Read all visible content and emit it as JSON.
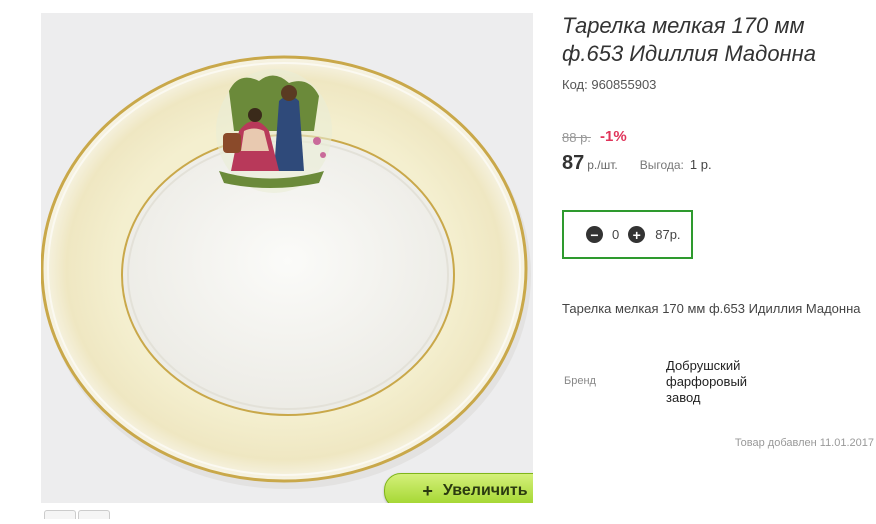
{
  "product": {
    "title": "Тарелка мелкая 170 мм ф.653 Идиллия Мадонна",
    "code_label": "Код:",
    "code": "960855903",
    "old_price": "88 р.",
    "discount": "-1%",
    "price": "87",
    "price_unit": "р./шт.",
    "profit_label": "Выгода:",
    "profit_value": "1 р.",
    "description": "Тарелка мелкая 170 мм ф.653 Идиллия Мадонна",
    "brand_label": "Бренд",
    "brand_value": "Добрушский фарфоровый завод",
    "added_text": "Товар добавлен 11.01.2017"
  },
  "cart": {
    "minus_icon": "minus-circle-icon",
    "quantity": "0",
    "plus_icon": "plus-circle-icon",
    "total": "87р."
  },
  "gallery": {
    "zoom_icon": "+",
    "zoom_label": "Увеличить"
  },
  "colors": {
    "accent_green": "#2e9a2e",
    "discount_red": "#e0345a",
    "zoom_button": "#9fd42a"
  }
}
